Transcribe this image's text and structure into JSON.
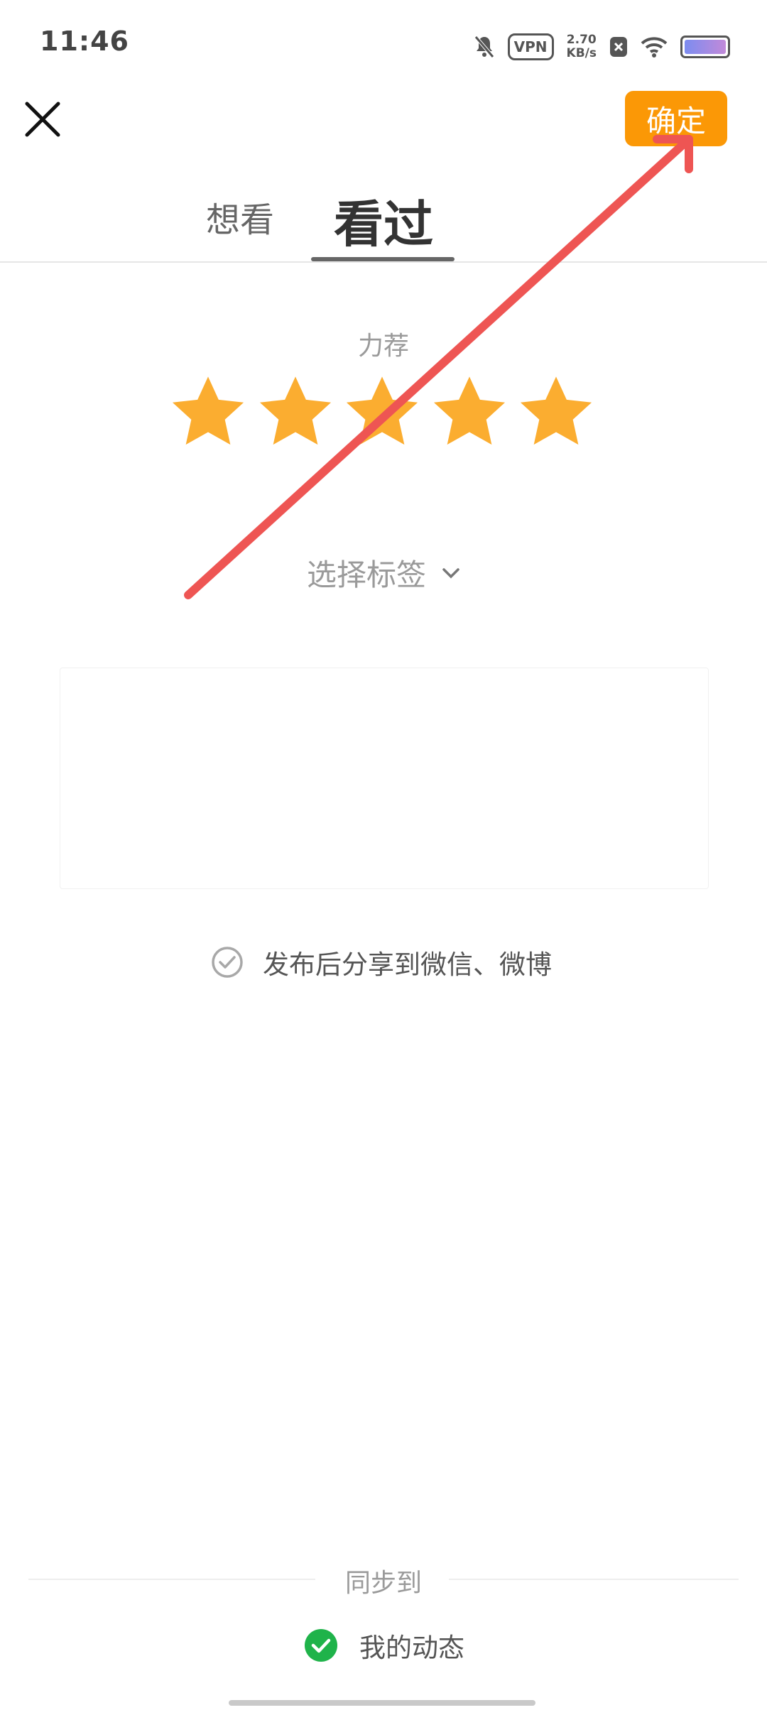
{
  "status_bar": {
    "time": "11:46",
    "vpn": "VPN",
    "speed_value": "2.70",
    "speed_unit": "KB/s",
    "icons": [
      "mute-bell-icon",
      "close-square-icon",
      "wifi-icon",
      "battery-icon"
    ]
  },
  "header": {
    "close_icon": "close-icon",
    "confirm_label": "确定"
  },
  "tabs": [
    {
      "label": "想看",
      "selected": false
    },
    {
      "label": "看过",
      "selected": true
    }
  ],
  "rating": {
    "label": "力荐",
    "value": 5,
    "max": 5,
    "star_color": "#fbad30"
  },
  "tags": {
    "label": "选择标签"
  },
  "comment": {
    "value": ""
  },
  "share": {
    "label": "发布后分享到微信、微博",
    "checked": false
  },
  "sync": {
    "title": "同步到",
    "target_label": "我的动态",
    "checked": true,
    "check_color": "#1fb34a"
  },
  "accent_colors": {
    "confirm": "#fb9806",
    "annotation_arrow": "#ee5553"
  }
}
